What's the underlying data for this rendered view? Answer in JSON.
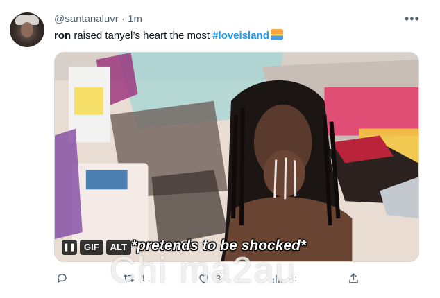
{
  "tweet": {
    "handle": "@santanaluvr",
    "separator": "·",
    "time": "1m",
    "text_bold": "ron",
    "text_main": " raised tanyel’s heart the most ",
    "hashtag": "#loveisland",
    "emoji": "sunrise-emoji"
  },
  "media": {
    "caption": "*pretends to be shocked*",
    "gif_label": "GIF",
    "alt_label": "ALT",
    "pause_symbol": "❚❚"
  },
  "actions": {
    "reply_count": "",
    "retweet_count": "1",
    "like_count": "3",
    "views_count": "1:"
  },
  "watermark": "Chi ma2au",
  "colors": {
    "accent": "#1d9bf0",
    "secondary_text": "#536471"
  }
}
